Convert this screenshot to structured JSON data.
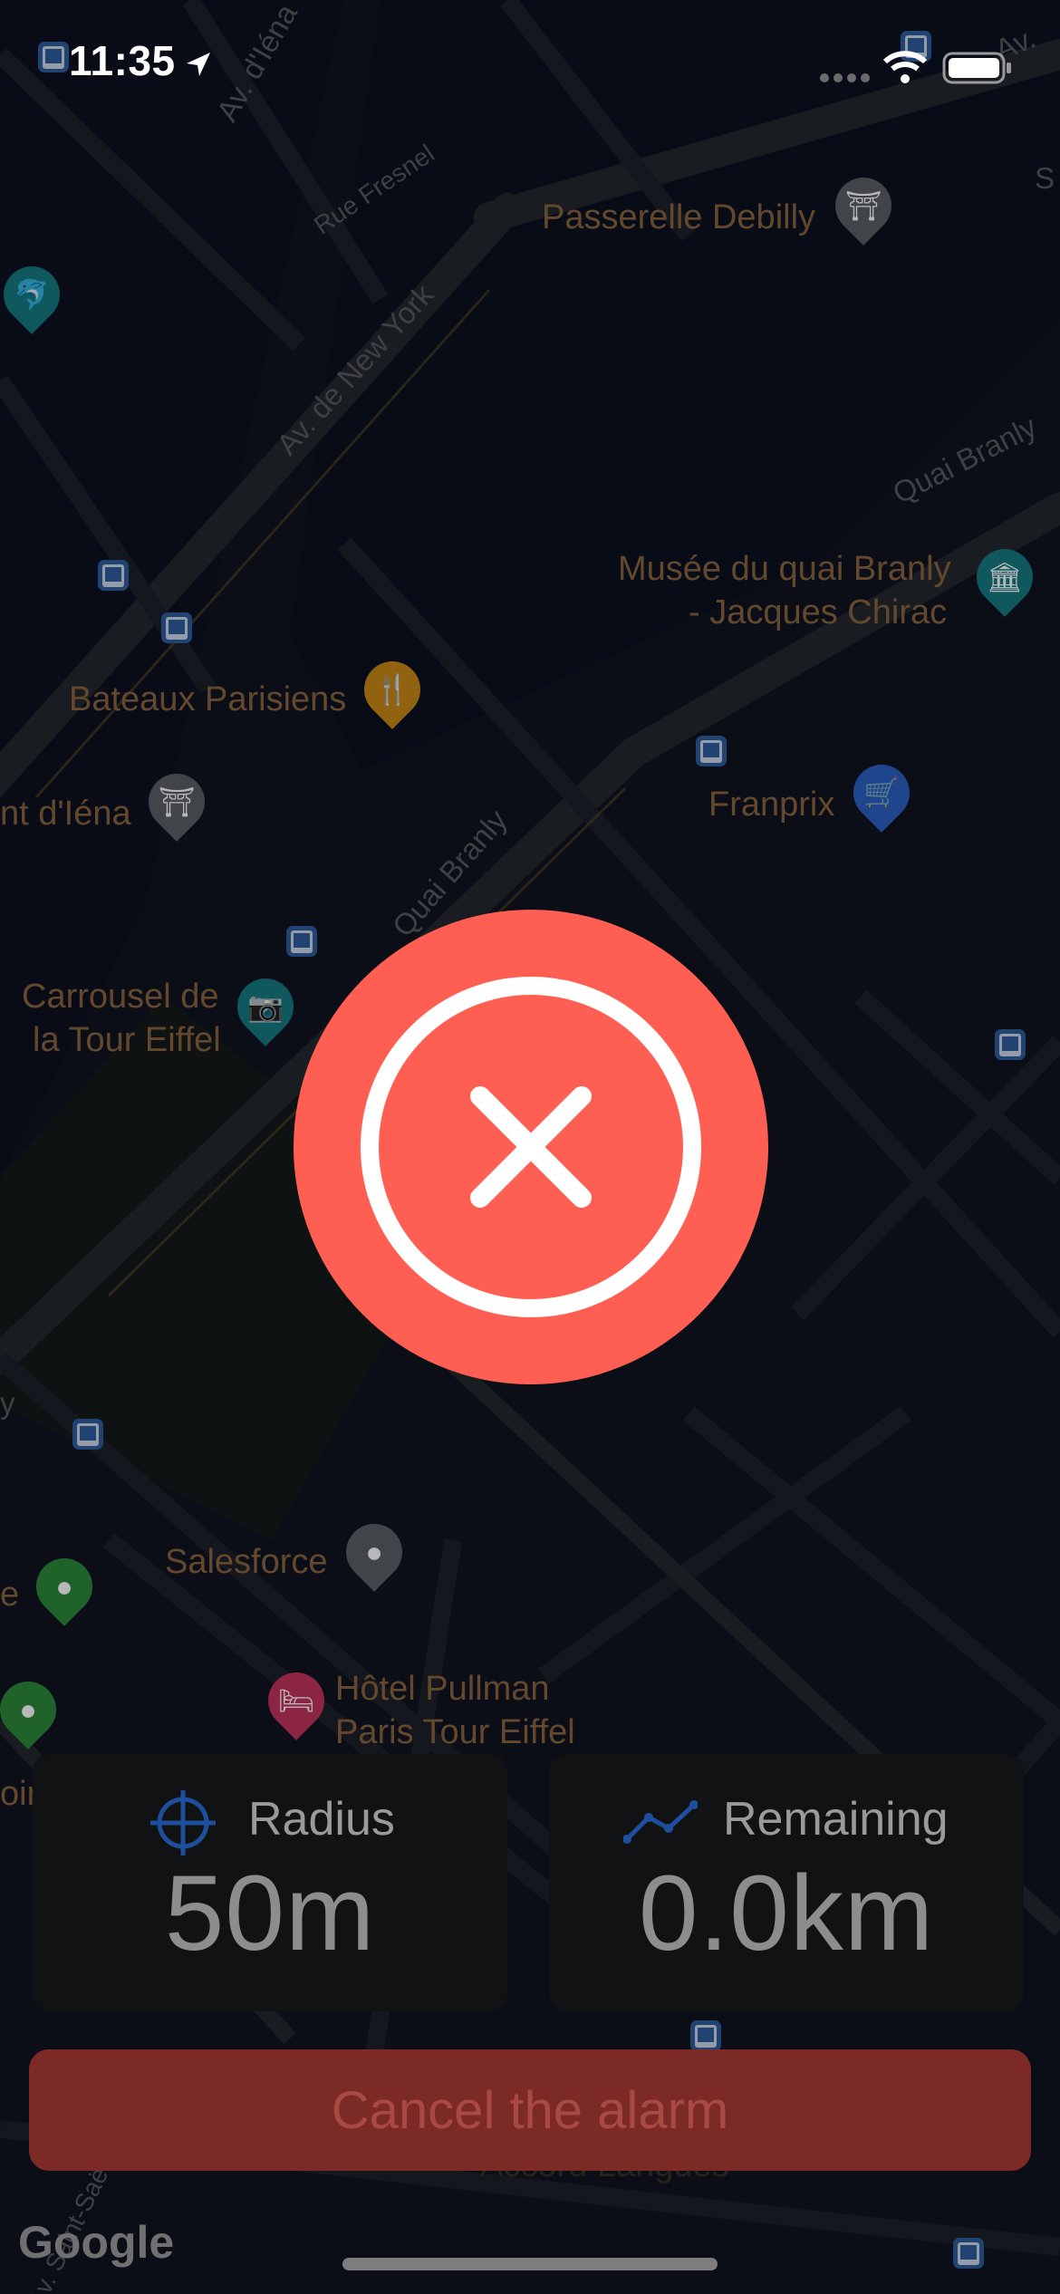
{
  "status_bar": {
    "time": "11:35"
  },
  "map": {
    "places": {
      "passerelle": "Passerelle Debilly",
      "musee_line1": "Musée du quai Branly",
      "musee_line2": "- Jacques Chirac",
      "bateaux": "Bateaux Parisiens",
      "pont": "nt d'Iéna",
      "franprix": "Franprix",
      "carrousel_line1": "Carrousel de",
      "carrousel_line2": "la Tour Eiffel",
      "salesforce": "Salesforce",
      "pullman_line1": "Hôtel Pullman",
      "pullman_line2": "Paris Tour Eiffel",
      "partial_e": "e",
      "partial_oine": "oine",
      "accord": "Accord Langues"
    },
    "roads": {
      "av_iena": "Av. d'Iéna",
      "rue_fresnel": "Rue Fresnel",
      "av_new_york": "Av. de New York",
      "quai_branly_top": "Quai Branly",
      "quai_branly_mid": "Quai Branly",
      "av_right": "Av.",
      "av_saint_saens": "Av. Saint-Saë",
      "partial_s": "S",
      "partial_y": "y"
    }
  },
  "alarm": {
    "state": "cancelled",
    "icon": "close-icon",
    "color": "#ff5f52"
  },
  "cards": {
    "radius": {
      "title": "Radius",
      "value": "50m",
      "icon": "crosshair-icon"
    },
    "remaining": {
      "title": "Remaining",
      "value": "0.0km",
      "icon": "route-icon"
    }
  },
  "cancel_button": {
    "label": "Cancel the alarm"
  },
  "attribution": "Google",
  "colors": {
    "icon_blue": "#1e4f9e",
    "cancel_bg": "#7b2a25",
    "cancel_text": "#a84a43"
  }
}
